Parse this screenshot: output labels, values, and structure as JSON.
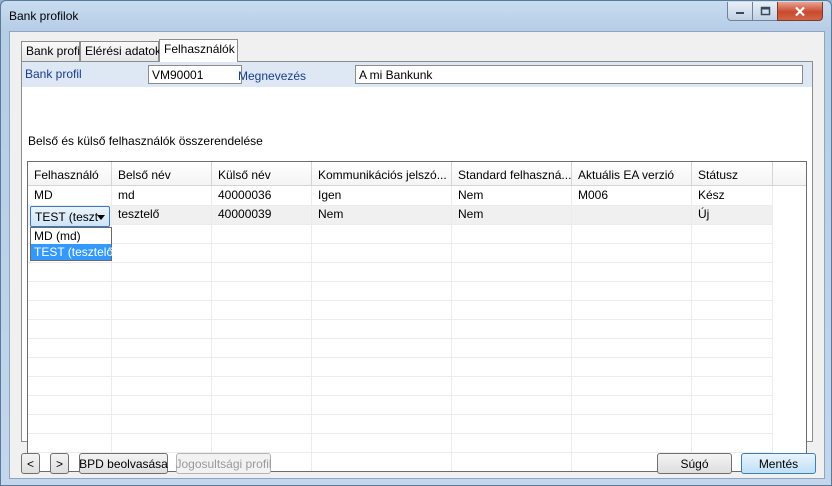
{
  "window": {
    "title": "Bank profilok"
  },
  "tabs": [
    {
      "label": "Bank profil"
    },
    {
      "label": "Elérési adatok"
    },
    {
      "label": "Felhasználók"
    }
  ],
  "profile": {
    "bank_profil_label": "Bank profil",
    "bank_profil_value": "VM90001",
    "megnevezes_label": "Megnevezés",
    "megnevezes_value": "A mi Bankunk"
  },
  "section_title": "Belső és külső felhasználók összerendelése",
  "table": {
    "columns": [
      "Felhasználó",
      "Belső név",
      "Külső név",
      "Kommunikációs jelszó...",
      "Standard felhaszná...",
      "Aktuális EA verzió",
      "Státusz"
    ],
    "rows": [
      [
        "MD",
        "md",
        "40000036",
        "Igen",
        "Nem",
        "M006",
        "Kész"
      ],
      [
        "TEST (teszt",
        "tesztelő",
        "40000039",
        "Nem",
        "Nem",
        "",
        "Új"
      ]
    ]
  },
  "dropdown": {
    "options": [
      "MD (md)",
      "TEST (tesztelő)"
    ],
    "selected_index": 1
  },
  "footer": {
    "prev_label": "<",
    "next_label": ">",
    "bpd_label": "BPD beolvasása",
    "jog_label": "Jogosultsági profil",
    "help_label": "Súgó",
    "save_label": "Mentés"
  },
  "colors": {
    "header_bg": "#dde8f4",
    "selection": "#3399ff",
    "label_blue": "#1a3c8c"
  }
}
